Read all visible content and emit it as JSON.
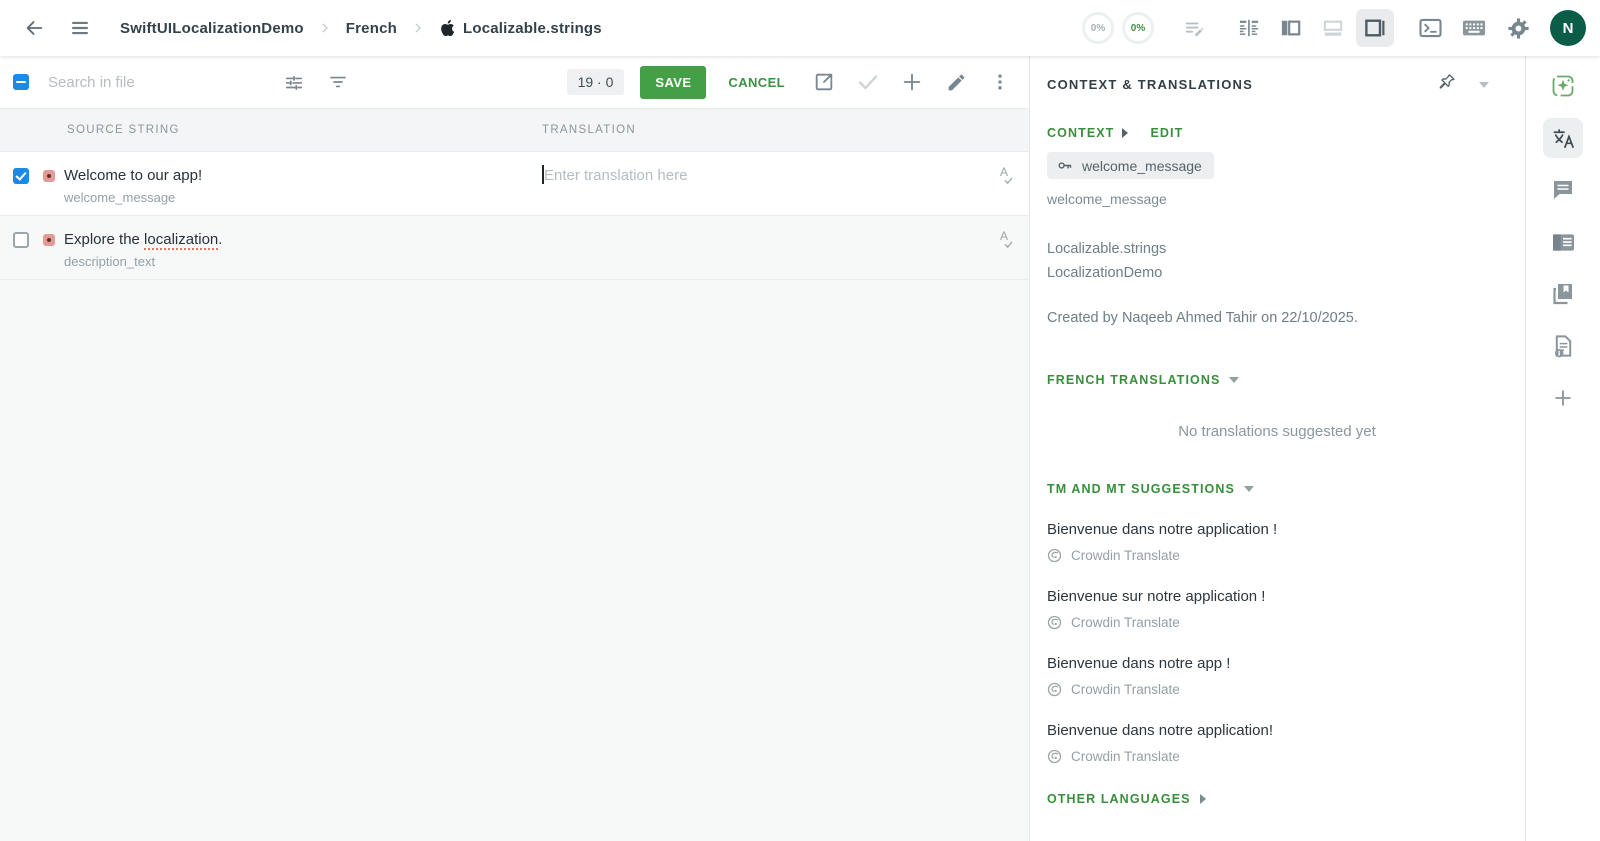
{
  "header": {
    "breadcrumb": {
      "project": "SwiftUILocalizationDemo",
      "language": "French",
      "file": "Localizable.strings"
    },
    "progress": [
      {
        "label": "0%"
      },
      {
        "label": "0%"
      }
    ],
    "avatar_initial": "N",
    "icons": [
      "back-arrow",
      "menu",
      "draft-suggestions",
      "comfortable-view",
      "side-by-side-view",
      "multilingual-view",
      "right-panel-view",
      "console",
      "keyboard",
      "settings",
      "avatar"
    ]
  },
  "toolbar": {
    "search_placeholder": "Search in file",
    "counter": "19 · 0",
    "save_label": "SAVE",
    "cancel_label": "CANCEL",
    "icons": [
      "filter-settings",
      "filter",
      "copy-source",
      "approve-check",
      "add-string",
      "edit",
      "more-menu"
    ]
  },
  "table": {
    "col_source": "SOURCE STRING",
    "col_translation": "TRANSLATION",
    "rows": [
      {
        "source": "Welcome to our app!",
        "key": "welcome_message",
        "placeholder": "Enter translation here",
        "checked": true
      },
      {
        "source_prefix": "Explore the ",
        "source_misspelled": "localization",
        "source_suffix": ".",
        "key": "description_text",
        "checked": false
      }
    ]
  },
  "panel": {
    "title": "CONTEXT & TRANSLATIONS",
    "context_label": "CONTEXT",
    "edit_label": "EDIT",
    "key_chip": "welcome_message",
    "key_plain": "welcome_message",
    "file_name": "Localizable.strings",
    "project_name": "LocalizationDemo",
    "created_line": "Created by Naqeeb Ahmed Tahir on 22/10/2025.",
    "translations_header": "FRENCH TRANSLATIONS",
    "no_translations": "No translations suggested yet",
    "suggestions_header": "TM AND MT SUGGESTIONS",
    "suggestions": [
      {
        "text": "Bienvenue dans notre application !",
        "provider": "Crowdin Translate"
      },
      {
        "text": "Bienvenue sur notre application !",
        "provider": "Crowdin Translate"
      },
      {
        "text": "Bienvenue dans notre app !",
        "provider": "Crowdin Translate"
      },
      {
        "text": "Bienvenue dans notre application!",
        "provider": "Crowdin Translate"
      }
    ],
    "other_languages": "OTHER LANGUAGES",
    "icons": [
      "unpin",
      "collapse-caret",
      "key",
      "crowdin-translate-logo"
    ]
  },
  "right_bar": {
    "icons": [
      "ai-assistant",
      "translations",
      "comments",
      "string-info",
      "glossary",
      "file-context",
      "add-panel"
    ]
  },
  "colors": {
    "accent_green": "#388e3c",
    "save_green": "#43a047",
    "checkbox_blue": "#1e88e5",
    "avatar_green": "#0b5d4a",
    "status_red": "#e59a93"
  }
}
